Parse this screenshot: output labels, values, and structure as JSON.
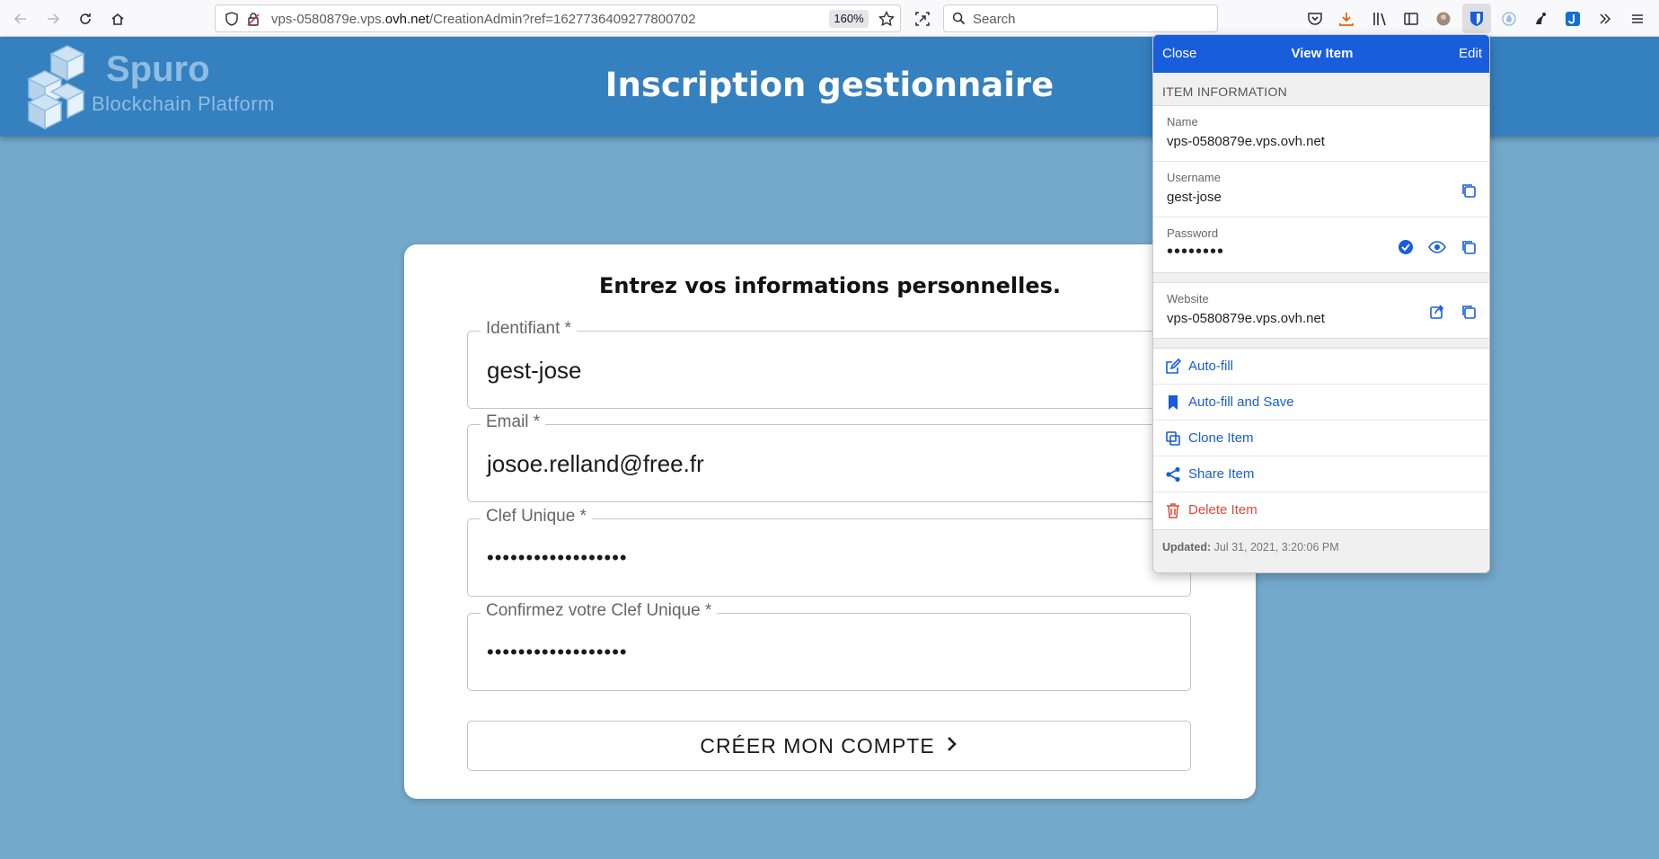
{
  "browser": {
    "url_prefix": "vps-0580879e.vps.",
    "url_domain": "ovh.net",
    "url_path": "/CreationAdmin?ref=1627736409277800702",
    "zoom": "160%",
    "search_placeholder": "Search"
  },
  "header": {
    "logo_name": "Spuro",
    "logo_subtitle": "Blockchain Platform",
    "title": "Inscription gestionnaire"
  },
  "form": {
    "heading": "Entrez vos informations personnelles.",
    "fields": [
      {
        "label": "Identifiant *",
        "value": "gest-jose"
      },
      {
        "label": "Email *",
        "value": "josoe.relland@free.fr"
      },
      {
        "label": "Clef Unique *",
        "value": "••••••••••••••••••"
      },
      {
        "label": "Confirmez votre Clef Unique *",
        "value": "••••••••••••••••••"
      }
    ],
    "submit_label": "CRÉER MON COMPTE"
  },
  "popup": {
    "close_label": "Close",
    "title": "View Item",
    "edit_label": "Edit",
    "section_title": "ITEM INFORMATION",
    "name_label": "Name",
    "name_value": "vps-0580879e.vps.ovh.net",
    "username_label": "Username",
    "username_value": "gest-jose",
    "password_label": "Password",
    "password_value": "••••••••",
    "website_label": "Website",
    "website_value": "vps-0580879e.vps.ovh.net",
    "actions": [
      {
        "label": "Auto-fill",
        "icon": "edit-icon"
      },
      {
        "label": "Auto-fill and Save",
        "icon": "bookmark-icon"
      },
      {
        "label": "Clone Item",
        "icon": "clone-icon"
      },
      {
        "label": "Share Item",
        "icon": "share-icon"
      },
      {
        "label": "Delete Item",
        "icon": "trash-icon"
      }
    ],
    "updated_label": "Updated:",
    "updated_value": "Jul 31, 2021, 3:20:06 PM"
  },
  "colors": {
    "page_background": "#74a9cc",
    "header_background": "#3580bf",
    "popup_accent": "#175ddc",
    "danger": "#dd4b39"
  }
}
